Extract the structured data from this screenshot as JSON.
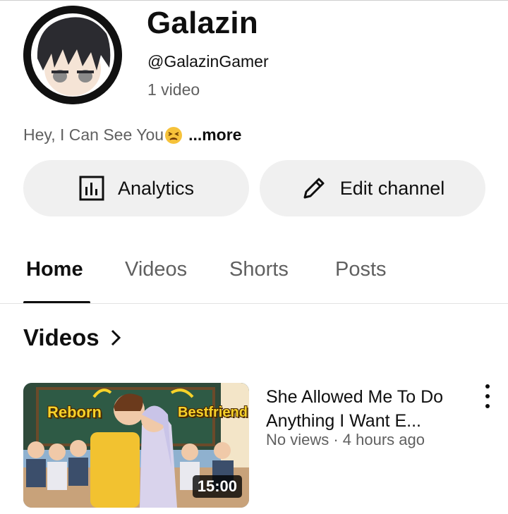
{
  "channel": {
    "name": "Galazin",
    "handle": "@GalazinGamer",
    "video_count": "1 video",
    "description": "Hey, I Can See You",
    "more_label": "...more"
  },
  "actions": {
    "analytics_label": "Analytics",
    "edit_label": "Edit channel"
  },
  "tabs": [
    {
      "label": "Home",
      "active": true
    },
    {
      "label": "Videos"
    },
    {
      "label": "Shorts"
    },
    {
      "label": "Posts"
    }
  ],
  "section": {
    "title": "Videos"
  },
  "videos": [
    {
      "title": "She Allowed Me To Do Anything I Want E...",
      "meta": "No views · 4 hours ago",
      "duration": "15:00",
      "thumbnail_text": [
        "Reborn",
        "Bestfriend"
      ]
    }
  ],
  "icons": {
    "analytics": "bar-chart-icon",
    "edit": "pencil-icon",
    "section_arrow": "chevron-right-icon",
    "more": "three-dot-menu-icon",
    "description_emoji": "tired-face-emoji"
  }
}
